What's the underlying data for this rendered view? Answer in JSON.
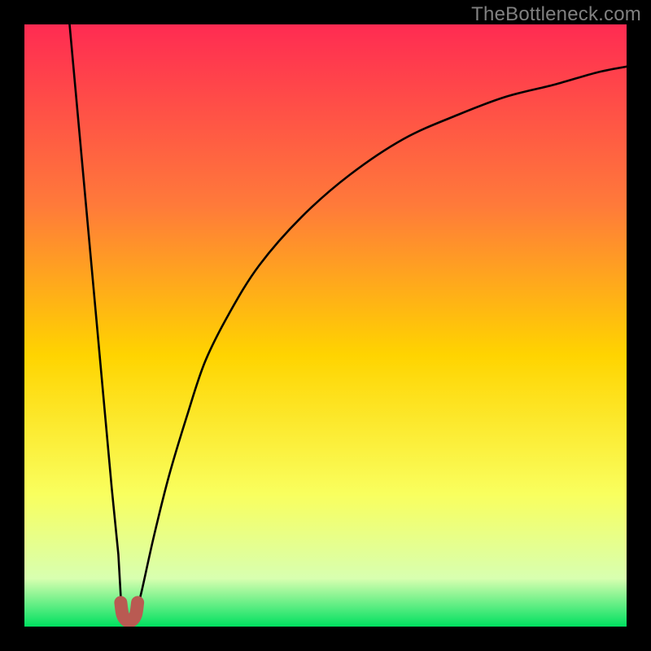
{
  "watermark": "TheBottleneck.com",
  "chart_data": {
    "type": "line",
    "title": "",
    "xlabel": "",
    "ylabel": "",
    "xlim": [
      0,
      100
    ],
    "ylim": [
      0,
      100
    ],
    "grid": false,
    "legend": false,
    "series": [
      {
        "name": "left-branch",
        "x": [
          7.5,
          8.5,
          9.5,
          10.5,
          11.5,
          12.5,
          13.5,
          14.5,
          15.6,
          16.0,
          16.3
        ],
        "values": [
          100,
          89,
          78,
          67,
          56,
          45,
          34,
          23,
          12,
          5,
          2
        ]
      },
      {
        "name": "right-branch",
        "x": [
          18.5,
          19.5,
          21.5,
          24.0,
          27.0,
          30.0,
          34.0,
          39.0,
          46.0,
          54.0,
          63.0,
          72.0,
          80.0,
          88.0,
          95.0,
          100.0
        ],
        "values": [
          2,
          6,
          15,
          25,
          35,
          44,
          52,
          60,
          68,
          75,
          81,
          85,
          88,
          90,
          92,
          93
        ]
      },
      {
        "name": "bottom-marker",
        "x": [
          16.0,
          16.3,
          17.0,
          17.8,
          18.5,
          18.8
        ],
        "values": [
          4,
          2,
          1,
          1,
          2,
          4
        ]
      }
    ],
    "gradient_colors": {
      "top": "#ff2b52",
      "mid_upper": "#ff7a3a",
      "mid": "#ffd400",
      "mid_lower": "#f9ff5e",
      "near_bottom": "#d8ffb0",
      "bottom": "#00e060"
    },
    "marker_color": "#b95a52",
    "curve_color": "#000000"
  }
}
